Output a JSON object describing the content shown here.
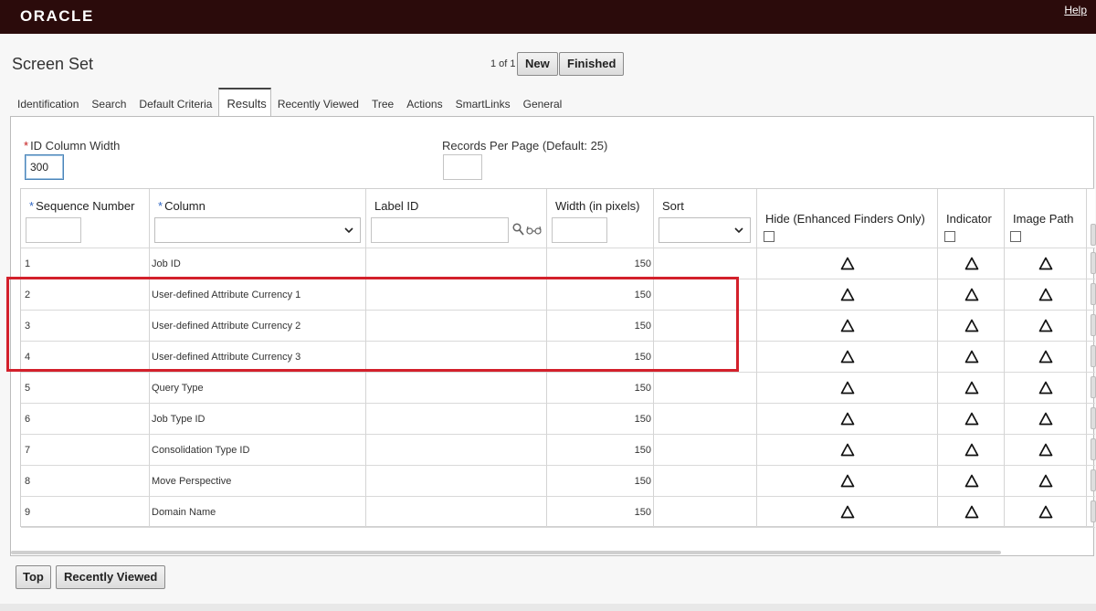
{
  "header": {
    "brand": "ORACLE",
    "help": "Help"
  },
  "page": {
    "title": "Screen Set",
    "pager": "1 of 1",
    "new_label": "New",
    "finished_label": "Finished"
  },
  "tabs": [
    {
      "label": "Identification"
    },
    {
      "label": "Search"
    },
    {
      "label": "Default Criteria"
    },
    {
      "label": "Results",
      "active": true
    },
    {
      "label": "Recently Viewed"
    },
    {
      "label": "Tree"
    },
    {
      "label": "Actions"
    },
    {
      "label": "SmartLinks"
    },
    {
      "label": "General"
    }
  ],
  "form": {
    "id_width_label": "ID Column Width",
    "id_width_value": "300",
    "records_label": "Records Per Page (Default: 25)",
    "records_value": ""
  },
  "grid": {
    "columns": {
      "sequence": "Sequence Number",
      "column": "Column",
      "label_id": "Label ID",
      "width": "Width (in pixels)",
      "sort": "Sort",
      "hide": "Hide (Enhanced Finders Only)",
      "indicator": "Indicator",
      "image_path": "Image Path"
    },
    "rows": [
      {
        "seq": "1",
        "column": "Job ID",
        "width": "150"
      },
      {
        "seq": "2",
        "column": "User-defined Attribute Currency 1",
        "width": "150"
      },
      {
        "seq": "3",
        "column": "User-defined Attribute Currency 2",
        "width": "150"
      },
      {
        "seq": "4",
        "column": "User-defined Attribute Currency 3",
        "width": "150"
      },
      {
        "seq": "5",
        "column": "Query Type",
        "width": "150"
      },
      {
        "seq": "6",
        "column": "Job Type ID",
        "width": "150"
      },
      {
        "seq": "7",
        "column": "Consolidation Type ID",
        "width": "150"
      },
      {
        "seq": "8",
        "column": "Move Perspective",
        "width": "150"
      },
      {
        "seq": "9",
        "column": "Domain Name",
        "width": "150"
      }
    ]
  },
  "footer": {
    "top_label": "Top",
    "recent_label": "Recently Viewed"
  },
  "icons": {
    "lookup": "magnifier-icon",
    "spectacles": "glasses-icon",
    "triangle": "triangle-icon"
  },
  "colors": {
    "header_bg": "#2b0b0b",
    "highlight": "#d3202b"
  }
}
